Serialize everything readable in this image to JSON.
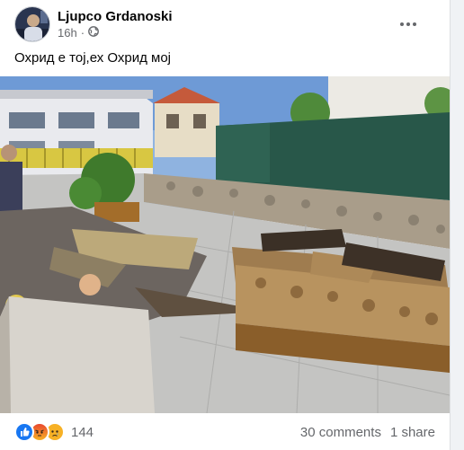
{
  "post": {
    "author": "Ljupco Grdanoski",
    "time": "16h",
    "separator": "·",
    "privacy_icon": "globe-icon",
    "text": "Охрид е тој,ех Охрид мој",
    "more_icon": "more-horizontal-icon"
  },
  "photo": {
    "alt_icon": "street-photo"
  },
  "footer": {
    "reactions": [
      "like",
      "angry",
      "sad"
    ],
    "reaction_count": "144",
    "comments": "30 comments",
    "shares": "1 share"
  },
  "colors": {
    "like": "#1877f2",
    "angry": "#f0772d",
    "sad": "#f7b125",
    "secondary_text": "#65676b"
  }
}
